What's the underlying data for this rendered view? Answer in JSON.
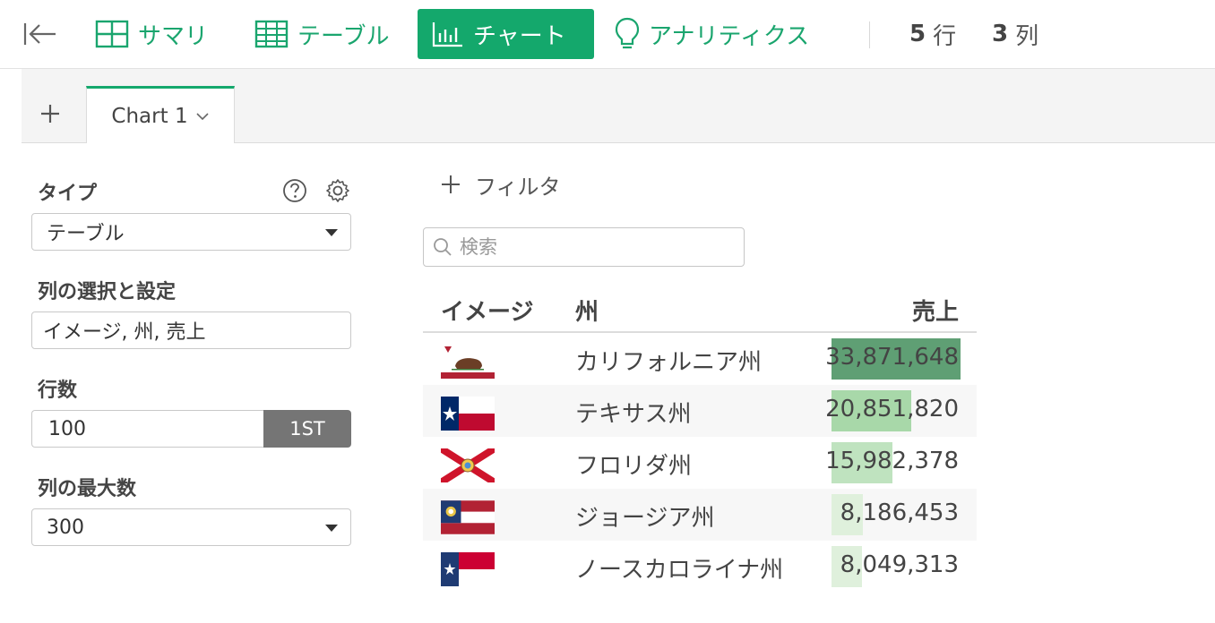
{
  "toolbar": {
    "nav": [
      {
        "label": "サマリ",
        "icon": "grid-icon"
      },
      {
        "label": "テーブル",
        "icon": "table-icon"
      },
      {
        "label": "チャート",
        "icon": "bar-chart-icon",
        "active": true
      },
      {
        "label": "アナリティクス",
        "icon": "lightbulb-icon"
      }
    ],
    "rows_count": "5",
    "rows_unit": "行",
    "cols_count": "3",
    "cols_unit": "列"
  },
  "tabs": {
    "active_label": "Chart 1"
  },
  "panel": {
    "type_label": "タイプ",
    "type_value": "テーブル",
    "columns_label": "列の選択と設定",
    "columns_value": "イメージ, 州, 売上",
    "rows_label": "行数",
    "rows_value": "100",
    "rows_button": "1ST",
    "max_cols_label": "列の最大数",
    "max_cols_value": "300"
  },
  "main": {
    "filter_label": "フィルタ",
    "search_placeholder": "検索",
    "table": {
      "headers": [
        "イメージ",
        "州",
        "売上"
      ],
      "max_value": 33871648,
      "rows": [
        {
          "flag": "california-flag",
          "state": "カリフォルニア州",
          "sales": "33,871,648",
          "value": 33871648,
          "bar_color": "#5f9f74"
        },
        {
          "flag": "texas-flag",
          "state": "テキサス州",
          "sales": "20,851,820",
          "value": 20851820,
          "bar_color": "#a8d8a9"
        },
        {
          "flag": "florida-flag",
          "state": "フロリダ州",
          "sales": "15,982,378",
          "value": 15982378,
          "bar_color": "#bfe3bf"
        },
        {
          "flag": "georgia-flag",
          "state": "ジョージア州",
          "sales": "8,186,453",
          "value": 8186453,
          "bar_color": "#dff0dc"
        },
        {
          "flag": "north-carolina-flag",
          "state": "ノースカロライナ州",
          "sales": "8,049,313",
          "value": 8049313,
          "bar_color": "#dff0dc"
        }
      ]
    }
  },
  "colors": {
    "accent": "#14a86c",
    "secondary_button": "#757575"
  }
}
